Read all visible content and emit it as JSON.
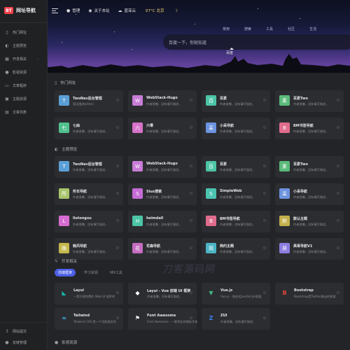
{
  "brand": {
    "badge": "BT",
    "name": "网址导航"
  },
  "sidebar": {
    "items": [
      {
        "icon": "bookmark-icon",
        "glyph": "▯",
        "label": "热门网址"
      },
      {
        "icon": "palette-icon",
        "glyph": "◐",
        "label": "主题预览"
      },
      {
        "icon": "store-icon",
        "glyph": "▦",
        "label": "开发相关",
        "has_arrow": true
      },
      {
        "icon": "film-icon",
        "glyph": "●",
        "label": "影视资源"
      },
      {
        "icon": "terminal-icon",
        "glyph": "▭",
        "label": "文章程序"
      },
      {
        "icon": "cube-icon",
        "glyph": "▣",
        "label": "主题资源"
      },
      {
        "icon": "document-icon",
        "glyph": "▤",
        "label": "文章列表"
      }
    ],
    "bottom": [
      {
        "icon": "upload-icon",
        "glyph": "↥",
        "label": "网站提交"
      },
      {
        "icon": "user-icon",
        "glyph": "●",
        "label": "友链管理"
      }
    ]
  },
  "topbar": {
    "links": [
      {
        "icon": "user-circle-icon",
        "glyph": "●",
        "label": "管理"
      },
      {
        "icon": "github-icon",
        "glyph": "◉",
        "label": "关于本站"
      },
      {
        "icon": "cloud-icon",
        "glyph": "☁",
        "label": "蓝菲云"
      }
    ],
    "weather": {
      "temp": "27°C",
      "city": "北京"
    },
    "moon_glyph": "☽"
  },
  "search": {
    "tabs": [
      "常用",
      "搜索",
      "工具",
      "社区",
      "生活"
    ],
    "placeholder": "百度一下，你就知道",
    "engine": "百度"
  },
  "sections": [
    {
      "title": "热门网址",
      "icon": "bookmark-icon",
      "glyph": "▯",
      "cards": [
        {
          "title": "TwoNav后台管理",
          "desc": "暂无描述admin",
          "initial": "T",
          "color": "#5b9fd6"
        },
        {
          "title": "WebStack-Hugo",
          "desc": "作者很懒，没有填写描述。",
          "initial": "W",
          "color": "#c87cd6"
        },
        {
          "title": "百素",
          "desc": "作者很懒，没有填写描述。",
          "initial": "百",
          "color": "#4cc4a6"
        },
        {
          "title": "百素Two",
          "desc": "作者很懒，没有填写描述。",
          "initial": "素",
          "color": "#5aba7a"
        },
        {
          "title": "七曲",
          "desc": "作者很懒，没有填写描述。",
          "initial": "七",
          "color": "#52c08e"
        },
        {
          "title": "六零",
          "desc": "作者很懒，没有填写描述。",
          "initial": "六",
          "color": "#d772c9"
        },
        {
          "title": "小呆导航",
          "desc": "作者很懒，没有填写描述。",
          "initial": "呆",
          "color": "#6c93e0"
        },
        {
          "title": "BM书签导航",
          "desc": "作者很懒，没有填写描述。",
          "initial": "B",
          "color": "#e06c8c"
        }
      ]
    },
    {
      "title": "主题预览",
      "icon": "palette-icon",
      "glyph": "◐",
      "cards": [
        {
          "title": "TwoNav后台管理",
          "desc": "作者很懒，没有填写描述。",
          "initial": "T",
          "color": "#5b9fd6"
        },
        {
          "title": "WebStack-Hugo",
          "desc": "作者很懒，没有填写描述。",
          "initial": "W",
          "color": "#c87cd6"
        },
        {
          "title": "百素",
          "desc": "作者很懒，没有填写描述。",
          "initial": "百",
          "color": "#4cc4a6"
        },
        {
          "title": "百素Two",
          "desc": "作者很懒，没有填写描述。",
          "initial": "素",
          "color": "#5aba7a"
        },
        {
          "title": "所长导航",
          "desc": "作者很懒，没有填写描述。",
          "initial": "所",
          "color": "#a8c46c"
        },
        {
          "title": "Siux搜索",
          "desc": "作者很懒，没有填写描述。",
          "initial": "S",
          "color": "#c46cd6"
        },
        {
          "title": "SimpleWeb",
          "desc": "作者很懒，没有填写描述。",
          "initial": "S",
          "color": "#4cc4b0"
        },
        {
          "title": "小呆导航",
          "desc": "作者很懒，没有填写描述。",
          "initial": "呆",
          "color": "#6c93e0"
        },
        {
          "title": "liutongxu",
          "desc": "作者很懒，没有填写描述。",
          "initial": "L",
          "color": "#d66cd0"
        },
        {
          "title": "heimdall",
          "desc": "作者很懒，没有填写描述。",
          "initial": "H",
          "color": "#4cc4a6"
        },
        {
          "title": "BM书签导航",
          "desc": "作者很懒，没有填写描述。",
          "initial": "B",
          "color": "#e06c8c"
        },
        {
          "title": "默认主题",
          "desc": "作者很懒，没有填写描述。",
          "initial": "默",
          "color": "#c4b04c"
        },
        {
          "title": "晚风导航",
          "desc": "作者很懒，没有填写描述。",
          "initial": "晚",
          "color": "#c4b84c"
        },
        {
          "title": "花森导航",
          "desc": "作者很懒，没有填写描述。",
          "initial": "花",
          "color": "#c46cc0"
        },
        {
          "title": "简约主题",
          "desc": "作者很懒，没有填写描述。",
          "initial": "简",
          "color": "#4cb4c4"
        },
        {
          "title": "昊哥导航V1",
          "desc": "作者很懒，没有填写描述。",
          "initial": "昊",
          "color": "#8c7ce0"
        }
      ]
    },
    {
      "title": "开发相关",
      "icon": "edit-icon",
      "glyph": "✎",
      "tabs": [
        "前端框架",
        "学习资源",
        "MR工具"
      ],
      "cards": [
        {
          "title": "Layui",
          "desc": "一套开源免费的 Web UI 组件库",
          "icon": "layui-icon",
          "glyph": "◣",
          "fg": "#16baaa"
        },
        {
          "title": "Layui - Vue 前端 UI 框架",
          "desc": "作者很懒，没有填写描述。",
          "icon": "layui-vue-icon",
          "glyph": "◆",
          "fg": "#ffffff"
        },
        {
          "title": "Vue.js",
          "desc": "Vue.js - 渐进式JavaScript框架",
          "icon": "vue-icon",
          "glyph": "▼",
          "fg": "#41b883"
        },
        {
          "title": "Bootstrap",
          "desc": "Bootstrap是Twitter推出的框架",
          "icon": "bootstrap-icon",
          "glyph": "B",
          "fg": "#e0453a"
        },
        {
          "title": "Tailwind",
          "desc": "Tailwind CSS 是一个功能类优先",
          "icon": "tailwind-icon",
          "glyph": "≈",
          "fg": "#38bdf8"
        },
        {
          "title": "Font Awesome",
          "desc": "Font Awesome - 一套绝佳的图标字体",
          "icon": "font-awesome-icon",
          "glyph": "⚑",
          "fg": "#ffffff"
        },
        {
          "title": "ZUI",
          "desc": "作者很懒，没有填写描述。",
          "icon": "zui-icon",
          "glyph": "Z",
          "fg": "#3b82f6"
        }
      ]
    },
    {
      "title": "影视资源",
      "icon": "film-icon",
      "glyph": "●"
    }
  ],
  "watermark": "刀客源码网",
  "colors": {
    "accent": "#4c5fe6",
    "brand": "#f1404b",
    "card": "#2c2d31",
    "background": "#232427"
  }
}
